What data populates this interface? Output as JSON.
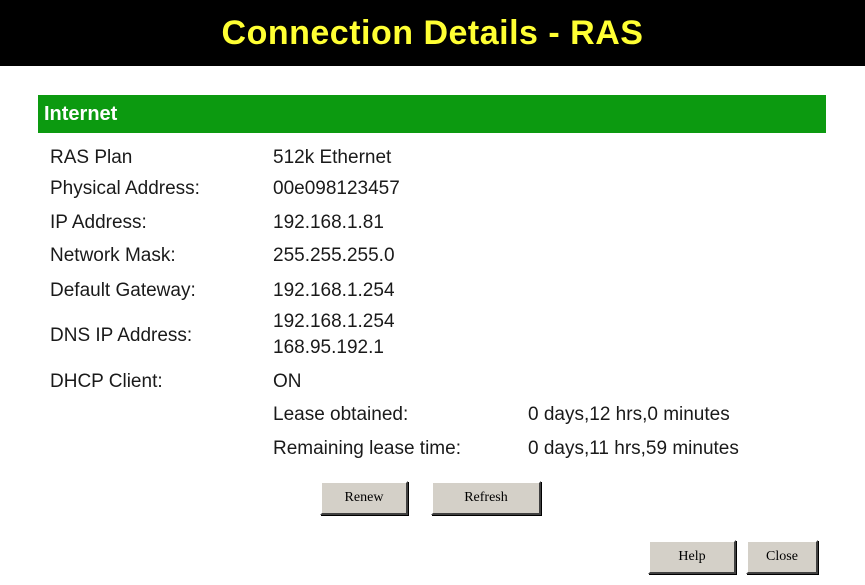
{
  "window": {
    "title": "Connection Details - RAS"
  },
  "section": {
    "title": "Internet"
  },
  "details": {
    "ras_plan": {
      "label": "RAS Plan",
      "value": "512k Ethernet"
    },
    "physical_address": {
      "label": "Physical Address:",
      "value": "00e098123457"
    },
    "ip_address": {
      "label": "IP Address:",
      "value": "192.168.1.81"
    },
    "network_mask": {
      "label": "Network Mask:",
      "value": "255.255.255.0"
    },
    "default_gateway": {
      "label": "Default Gateway:",
      "value": "192.168.1.254"
    },
    "dns_ip_address": {
      "label": "DNS IP Address:",
      "values": [
        "192.168.1.254",
        "168.95.192.1"
      ]
    },
    "dhcp_client": {
      "label": "DHCP Client:",
      "value": "ON"
    },
    "lease_obtained": {
      "label": "Lease obtained:",
      "value": "0 days,12 hrs,0 minutes"
    },
    "remaining_lease_time": {
      "label": "Remaining lease time:",
      "value": "0 days,11 hrs,59 minutes"
    }
  },
  "buttons": {
    "renew": "Renew",
    "refresh": "Refresh",
    "help": "Help",
    "close": "Close"
  },
  "colors": {
    "title_bar_bg": "#000000",
    "title_text": "#ffff33",
    "section_bar_bg": "#0c9a10",
    "section_text": "#ffffff",
    "button_face": "#d4d0c8"
  }
}
